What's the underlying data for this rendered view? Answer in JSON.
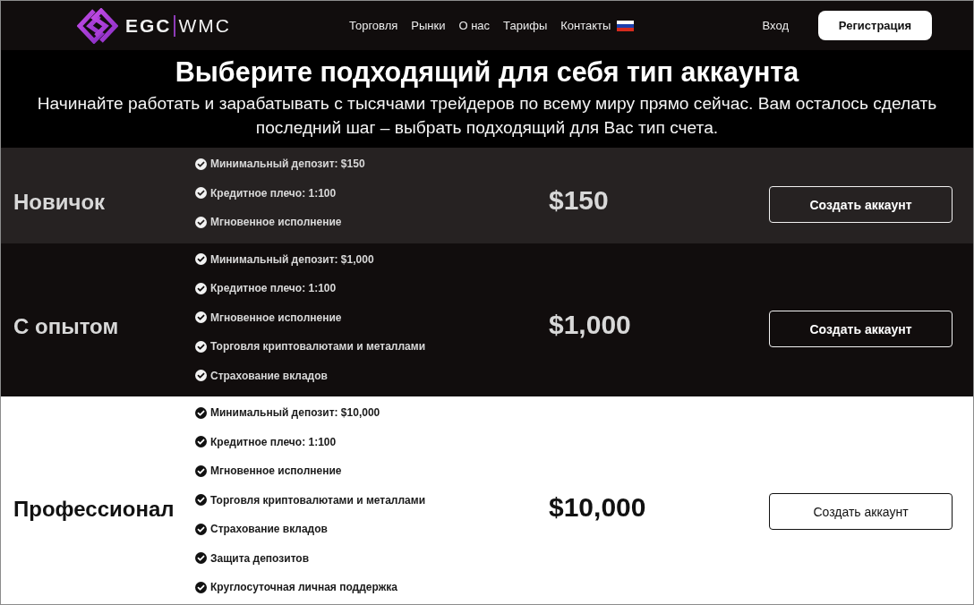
{
  "header": {
    "logo": {
      "left": "EGC",
      "right": "WMC"
    },
    "nav": [
      "Торговля",
      "Рынки",
      "О нас",
      "Тарифы",
      "Контакты"
    ],
    "login": "Вход",
    "register": "Регистрация"
  },
  "hero": {
    "title": "Выберите подходящий для себя тип аккаунта",
    "subtitle": "Начинайте работать и зарабатывать с тысячами трейдеров по всему миру прямо сейчас. Вам осталось сделать последний шаг – выбрать подходящий для Вас тип счета."
  },
  "plans": [
    {
      "kind": "dim",
      "name": "Новичок",
      "features": [
        "Минимальный депозит: $150",
        "Кредитное плечо: 1:100",
        "Мгновенное исполнение"
      ],
      "price": "$150",
      "button": "Создать аккаунт"
    },
    {
      "kind": "dark",
      "name": "С опытом",
      "features": [
        "Минимальный депозит: $1,000",
        "Кредитное плечо: 1:100",
        "Мгновенное исполнение",
        "Торговля криптовалютами и металлами",
        "Страхование вкладов"
      ],
      "price": "$1,000",
      "button": "Создать аккаунт"
    },
    {
      "kind": "light",
      "name": "Профессионал",
      "features": [
        "Минимальный депозит: $10,000",
        "Кредитное плечо: 1:100",
        "Мгновенное исполнение",
        "Торговля криптовалютами и металлами",
        "Страхование вкладов",
        "Защита депозитов",
        "Круглосуточная личная поддержка"
      ],
      "price": "$10,000",
      "button": "Создать аккаунт"
    }
  ]
}
